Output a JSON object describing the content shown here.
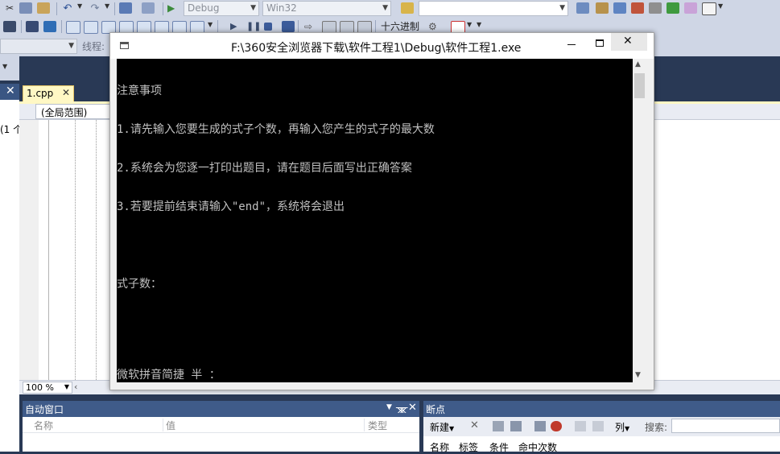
{
  "toolbar1": {
    "config": "Debug",
    "platform": "Win32"
  },
  "toolbar2": {
    "hex_label": "十六进制",
    "thread_label": "线程:"
  },
  "editor": {
    "tab_label": "1.cpp",
    "scope": "(全局范围)",
    "zoom": "100 %",
    "side_fragment": "(1 个"
  },
  "console": {
    "title": "F:\\360安全浏览器下载\\软件工程1\\Debug\\软件工程1.exe",
    "lines": [
      "注意事项",
      "1.请先输入您要生成的式子个数，再输入您产生的式子的最大数",
      "2.系统会为您逐一打印出题目，请在题目后面写出正确答案",
      "3.若要提前结束请输入\"end\"，系统将会退出",
      "",
      "式子数："
    ],
    "ime_status": "微软拼音简捷 半 ："
  },
  "autos": {
    "title": "自动窗口",
    "columns": [
      "名称",
      "值",
      "类型"
    ]
  },
  "breakpoints": {
    "title": "断点",
    "new_label": "新建",
    "columns_label": "列",
    "search_label": "搜索:",
    "columns": [
      "名称",
      "标签",
      "条件",
      "命中次数"
    ]
  },
  "icons": [
    "cut-icon",
    "copy-icon",
    "paste-icon",
    "undo-icon",
    "redo-icon",
    "start-debug-icon",
    "pause-icon",
    "stop-icon",
    "close-icon",
    "minimize-icon",
    "maximize-icon",
    "pin-icon",
    "delete-icon"
  ]
}
